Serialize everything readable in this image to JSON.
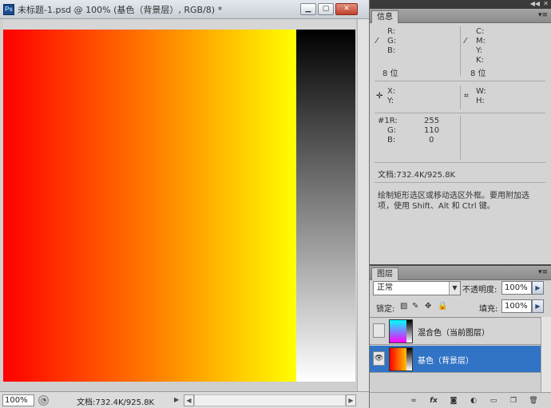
{
  "document": {
    "title": "未标题-1.psd @ 100% (基色（背景层）, RGB/8) *",
    "app_icon_label": "Ps",
    "zoom": "100%",
    "doc_size": "文档:732.4K/925.8K",
    "buttons": {
      "minimize": "▁",
      "maximize": "▢",
      "close": "✕"
    }
  },
  "info_panel": {
    "tab": "信息",
    "rgb": {
      "r": "R:",
      "g": "G:",
      "b": "B:"
    },
    "cmyk": {
      "c": "C:",
      "m": "M:",
      "y": "Y:",
      "k": "K:"
    },
    "bits_left": "8 位",
    "bits_right": "8 位",
    "xy": {
      "x": "X:",
      "y": "Y:"
    },
    "wh": {
      "w": "W:",
      "h": "H:"
    },
    "sample": {
      "r_label": "#1R:",
      "r_value": "255",
      "g_label": "G:",
      "g_value": "110",
      "b_label": "B:",
      "b_value": "0"
    },
    "doc_size": "文档:732.4K/925.8K",
    "hint_line1": "绘制矩形选区或移动选区外框。要用附加选",
    "hint_line2": "项，使用 Shift、Alt 和 Ctrl 键。"
  },
  "layers_panel": {
    "tab": "图层",
    "blend_mode": "正常",
    "opacity_label": "不透明度:",
    "opacity_value": "100%",
    "lock_label": "锁定:",
    "fill_label": "填充:",
    "fill_value": "100%",
    "layers": [
      {
        "name": "混合色（当前图层）",
        "visible": false,
        "selected": false
      },
      {
        "name": "基色（背景层）",
        "visible": true,
        "selected": true
      }
    ],
    "footer_icons": [
      "link-icon",
      "fx-icon",
      "mask-icon",
      "adjustment-icon",
      "group-icon",
      "new-layer-icon",
      "trash-icon"
    ],
    "footer_glyphs": [
      "∞",
      "fx",
      "◙",
      "◐",
      "▭",
      "❐",
      "🗑"
    ]
  },
  "colors": {
    "gradient_main": [
      "#ff0000",
      "#ffff00"
    ],
    "gradient_side": [
      "#000000",
      "#ffffff"
    ],
    "selected_layer": "#3173c5"
  }
}
